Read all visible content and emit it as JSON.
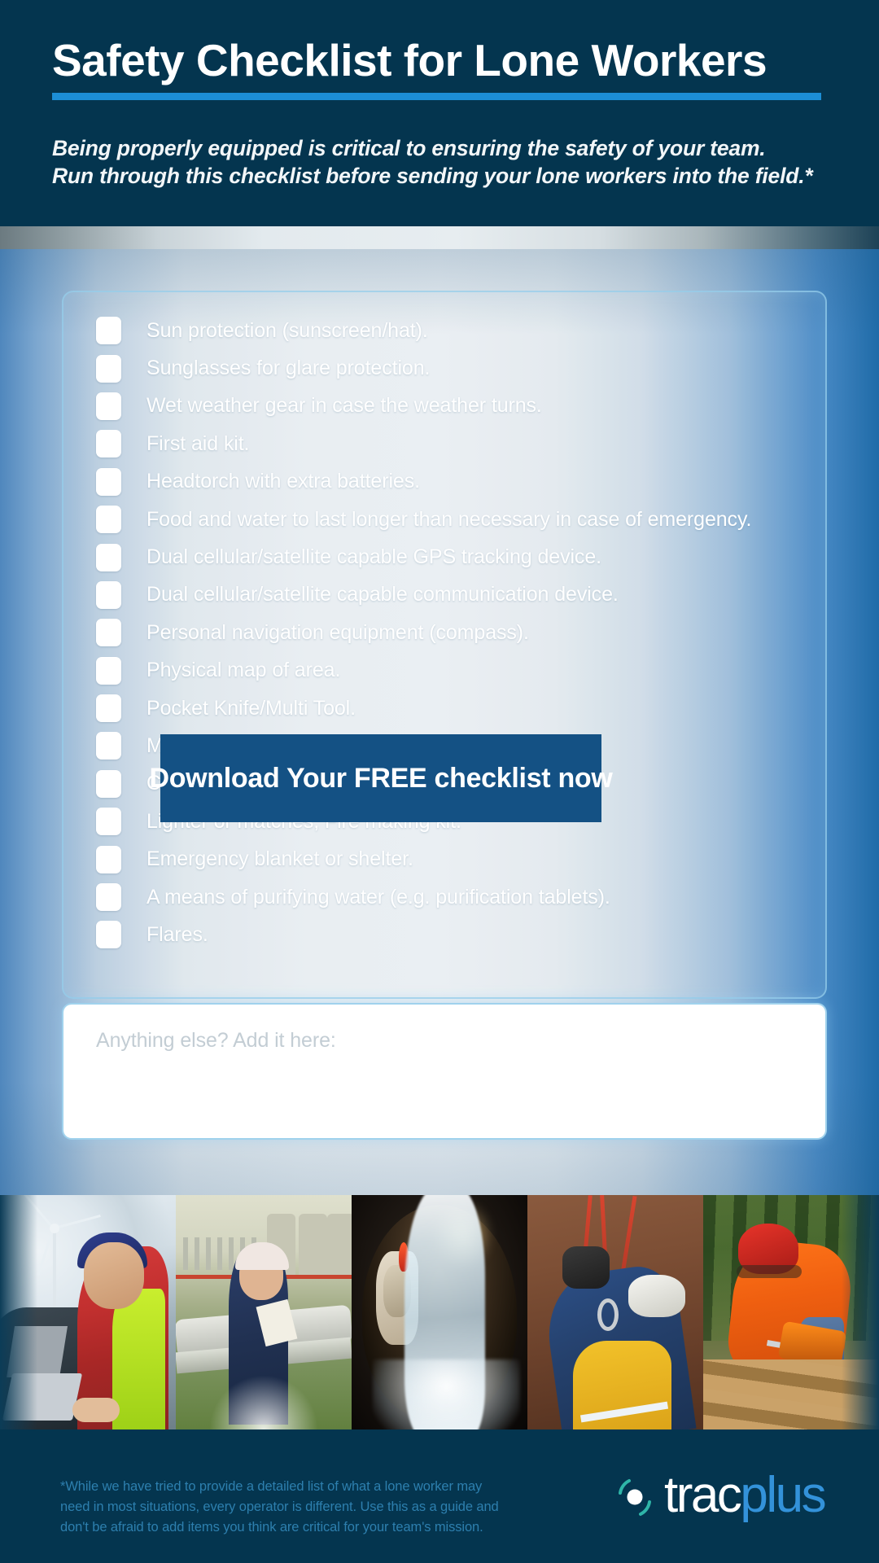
{
  "header": {
    "title": "Safety Checklist for Lone Workers",
    "subtitle_line1": "Being properly equipped is critical to ensuring the safety of your team.",
    "subtitle_line2": "Run through this checklist before sending your lone workers into the field.*",
    "accent_color": "#1c8ed6",
    "background_color": "#04354f"
  },
  "checklist": {
    "items": [
      {
        "label": "Sun protection (sunscreen/hat).",
        "checked": false
      },
      {
        "label": "Sunglasses for glare protection.",
        "checked": false
      },
      {
        "label": "Wet weather gear in case the weather turns.",
        "checked": false
      },
      {
        "label": "First aid kit.",
        "checked": false
      },
      {
        "label": "Headtorch with extra batteries.",
        "checked": false
      },
      {
        "label": "Food and water to last longer than necessary in case of emergency.",
        "checked": false
      },
      {
        "label": "Dual cellular/satellite capable GPS tracking device.",
        "checked": false
      },
      {
        "label": "Dual cellular/satellite capable communication device.",
        "checked": false
      },
      {
        "label": "Personal navigation equipment (compass).",
        "checked": false
      },
      {
        "label": "Physical map of area.",
        "checked": false
      },
      {
        "label": "Pocket Knife/Multi Tool.",
        "checked": false
      },
      {
        "label": "M",
        "checked": false
      },
      {
        "label": "C",
        "checked": false
      },
      {
        "label": "Lighter or matches, Fire making kit.",
        "checked": false
      },
      {
        "label": "Emergency blanket or shelter.",
        "checked": false
      },
      {
        "label": "A means of purifying water (e.g. purification tablets).",
        "checked": false
      },
      {
        "label": "Flares.",
        "checked": false
      }
    ]
  },
  "notes": {
    "placeholder": "Anything else? Add it here:",
    "value": ""
  },
  "cta": {
    "label": "Download Your FREE checklist now",
    "background_color": "#145184",
    "text_color": "#ffffff"
  },
  "photos": {
    "items": [
      {
        "alt": "field technician working on a laptop beside a vehicle near a wind turbine"
      },
      {
        "alt": "inspector with clipboard walking pipelines at a gas plant"
      },
      {
        "alt": "worker in a tunnel with water gushing from a large pipe"
      },
      {
        "alt": "rope access technician climbing with harness and carabiners"
      },
      {
        "alt": "forestry worker in helmet cutting logs with a chainsaw"
      }
    ]
  },
  "footer": {
    "disclaimer_line1": "*While we have tried to provide a detailed list of what a lone worker may",
    "disclaimer_line2": "need in most situations, every operator is different. Use this as a guide and",
    "disclaimer_line3": "don't be afraid to add items you think are critical for your team's mission.",
    "disclaimer_color": "#2d7fae",
    "logo": {
      "text_primary": "trac",
      "text_secondary": "plus",
      "primary_color": "#ffffff",
      "secondary_color": "#3392da",
      "mark": "satellite-signal-icon"
    }
  }
}
